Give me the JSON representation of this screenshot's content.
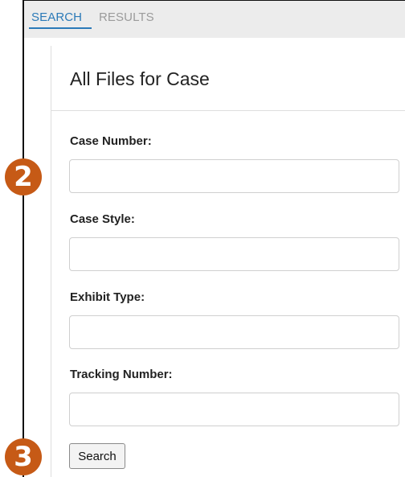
{
  "tabs": {
    "search_label": "SEARCH",
    "results_label": "RESULTS"
  },
  "page": {
    "title": "All Files for Case"
  },
  "form": {
    "case_number": {
      "label": "Case Number:",
      "value": "",
      "placeholder": ""
    },
    "case_style": {
      "label": "Case Style:",
      "value": "",
      "placeholder": ""
    },
    "exhibit_type": {
      "label": "Exhibit Type:",
      "value": "",
      "placeholder": ""
    },
    "tracking_number": {
      "label": "Tracking Number:",
      "value": "",
      "placeholder": ""
    },
    "search_button_label": "Search"
  },
  "annotations": {
    "step_2": "2",
    "step_3": "3"
  },
  "colors": {
    "accent_tab": "#2b7ab8",
    "inactive_tab": "#9b9b9b",
    "step_badge": "#c65a16",
    "tab_bar_bg": "#ececec"
  }
}
